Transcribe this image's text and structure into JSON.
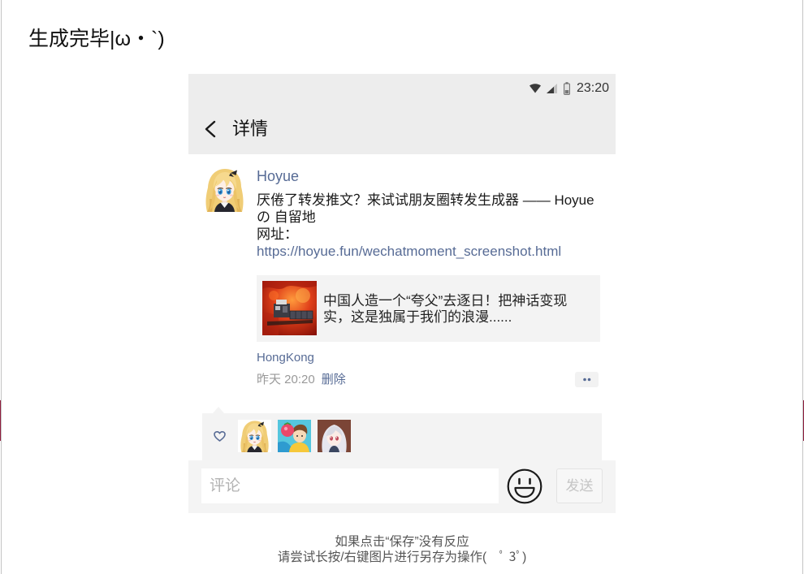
{
  "dialog": {
    "title": "生成完毕|ω・`)",
    "hint_line1": "如果点击“保存”没有反应",
    "hint_line2": "请尝试长按/右键图片进行另存为操作(　ﾟ 3ﾟ)"
  },
  "screenshot": {
    "status_bar": {
      "time": "23:20",
      "wifi_icon": "wifi-icon",
      "signal_icon": "signal-icon",
      "battery_icon": "battery-icon"
    },
    "nav": {
      "back_icon": "chevron-left-icon",
      "title": "详情"
    },
    "post": {
      "author": "Hoyue",
      "text": "厌倦了转发推文？来试试朋友圈转发生成器 —— Hoyue の 自留地",
      "url_label": "网址：",
      "url": "https://hoyue.fun/wechatmoment_screenshot.html",
      "link_card_title": "中国人造一个“夸父”去逐日！把神话变现实，这是独属于我们的浪漫......",
      "location": "HongKong",
      "time": "昨天 20:20",
      "delete_label": "删除",
      "more_icon": "more-dots-icon"
    },
    "likes": {
      "icon": "heart-outline-icon"
    },
    "comment_bar": {
      "placeholder": "评论",
      "emoji_icon": "smiley-icon",
      "send_label": "发送"
    }
  },
  "colors": {
    "link": "#576b95",
    "header_bg": "#ededed",
    "panel_bg": "#f3f3f3",
    "muted_text": "#999999"
  }
}
